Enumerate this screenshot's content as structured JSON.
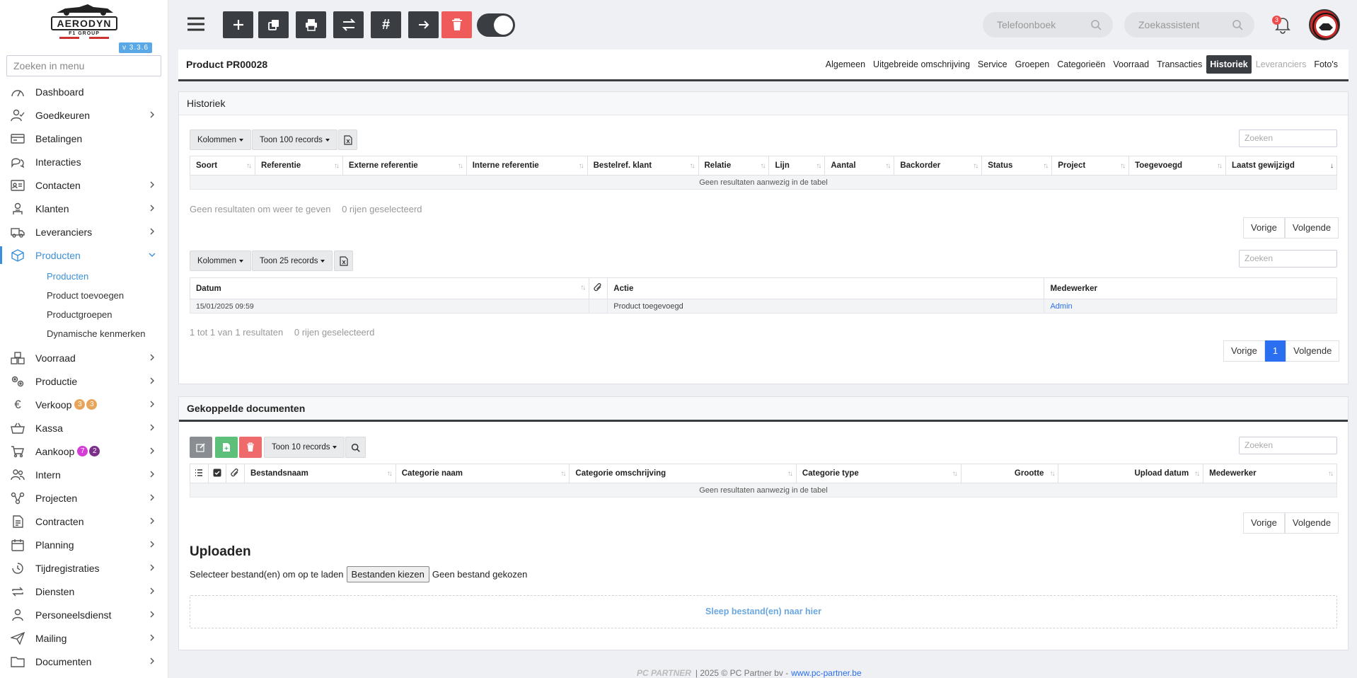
{
  "sidebar": {
    "logo_text": "AERODYN",
    "logo_sub": "F1 GROUP",
    "version": "v 3.3.6",
    "search_placeholder": "Zoeken in menu",
    "items": [
      {
        "label": "Dashboard",
        "icon": "gauge-icon",
        "chevron": false
      },
      {
        "label": "Goedkeuren",
        "icon": "user-check-icon",
        "chevron": true
      },
      {
        "label": "Betalingen",
        "icon": "credit-card-icon",
        "chevron": false
      },
      {
        "label": "Interacties",
        "icon": "chat-icon",
        "chevron": false
      },
      {
        "label": "Contacten",
        "icon": "id-card-icon",
        "chevron": true
      },
      {
        "label": "Klanten",
        "icon": "customer-icon",
        "chevron": true
      },
      {
        "label": "Leveranciers",
        "icon": "truck-icon",
        "chevron": true
      },
      {
        "label": "Producten",
        "icon": "box-icon",
        "chevron": true,
        "active": true
      }
    ],
    "sub_items": [
      "Producten",
      "Product toevoegen",
      "Productgroepen",
      "Dynamische kenmerken"
    ],
    "items_after": [
      {
        "label": "Voorraad",
        "icon": "boxes-icon"
      },
      {
        "label": "Productie",
        "icon": "gears-icon"
      },
      {
        "label": "Verkoop",
        "icon": "euro-icon",
        "badges": [
          {
            "value": "3",
            "color": "#e8a45a"
          },
          {
            "value": "3",
            "color": "#e8a45a"
          }
        ]
      },
      {
        "label": "Kassa",
        "icon": "basket-icon"
      },
      {
        "label": "Aankoop",
        "icon": "cart-icon",
        "badges": [
          {
            "value": "7",
            "color": "#d63cd6"
          },
          {
            "value": "2",
            "color": "#7b2f8a"
          }
        ]
      },
      {
        "label": "Intern",
        "icon": "users-icon"
      },
      {
        "label": "Projecten",
        "icon": "project-icon"
      },
      {
        "label": "Contracten",
        "icon": "contract-icon"
      },
      {
        "label": "Planning",
        "icon": "calendar-icon"
      },
      {
        "label": "Tijdregistraties",
        "icon": "timer-icon"
      },
      {
        "label": "Diensten",
        "icon": "repeat-icon"
      },
      {
        "label": "Personeelsdienst",
        "icon": "person-icon"
      },
      {
        "label": "Mailing",
        "icon": "send-icon"
      },
      {
        "label": "Documenten",
        "icon": "folder-icon"
      }
    ]
  },
  "topbar": {
    "search_phonebook": "Telefoonboek",
    "search_assistant": "Zoekassistent",
    "notification_count": "3"
  },
  "product": {
    "title": "Product PR00028",
    "tabs": [
      {
        "label": "Algemeen"
      },
      {
        "label": "Uitgebreide omschrijving"
      },
      {
        "label": "Service"
      },
      {
        "label": "Groepen"
      },
      {
        "label": "Categorieën"
      },
      {
        "label": "Voorraad"
      },
      {
        "label": "Transacties"
      },
      {
        "label": "Historiek",
        "active": true
      },
      {
        "label": "Leveranciers",
        "disabled": true
      },
      {
        "label": "Foto's"
      }
    ]
  },
  "historiek": {
    "title": "Historiek",
    "table1": {
      "columns_btn": "Kolommen",
      "show_btn": "Toon 100 records",
      "search_placeholder": "Zoeken",
      "headers": [
        "Soort",
        "Referentie",
        "Externe referentie",
        "Interne referentie",
        "Bestelref. klant",
        "Relatie",
        "Lijn",
        "Aantal",
        "Backorder",
        "Status",
        "Project",
        "Toegevoegd",
        "Laatst gewijzigd"
      ],
      "empty": "Geen resultaten aanwezig in de tabel",
      "info": "Geen resultaten om weer te geven",
      "selected": "0 rijen geselecteerd",
      "prev": "Vorige",
      "next": "Volgende"
    },
    "table2": {
      "columns_btn": "Kolommen",
      "show_btn": "Toon 25 records",
      "search_placeholder": "Zoeken",
      "headers": [
        "Datum",
        "Actie",
        "Medewerker"
      ],
      "rows": [
        {
          "datum": "15/01/2025 09:59",
          "actie": "Product toegevoegd",
          "medewerker": "Admin"
        }
      ],
      "info": "1 tot 1 van 1 resultaten",
      "selected": "0 rijen geselecteerd",
      "prev": "Vorige",
      "page": "1",
      "next": "Volgende"
    }
  },
  "documents": {
    "title": "Gekoppelde documenten",
    "show_btn": "Toon 10 records",
    "search_placeholder": "Zoeken",
    "headers": [
      "Bestandsnaam",
      "Categorie naam",
      "Categorie omschrijving",
      "Categorie type",
      "Grootte",
      "Upload datum",
      "Medewerker"
    ],
    "empty": "Geen resultaten aanwezig in de tabel",
    "prev": "Vorige",
    "next": "Volgende",
    "upload_title": "Uploaden",
    "upload_label": "Selecteer bestand(en) om op te laden",
    "choose_btn": "Bestanden kiezen",
    "no_file": "Geen bestand gekozen",
    "dropzone": "Sleep bestand(en) naar hier"
  },
  "footer": {
    "logo": "PC PARTNER",
    "copyright": "|  2025 © PC Partner bv -",
    "link": "www.pc-partner.be"
  }
}
